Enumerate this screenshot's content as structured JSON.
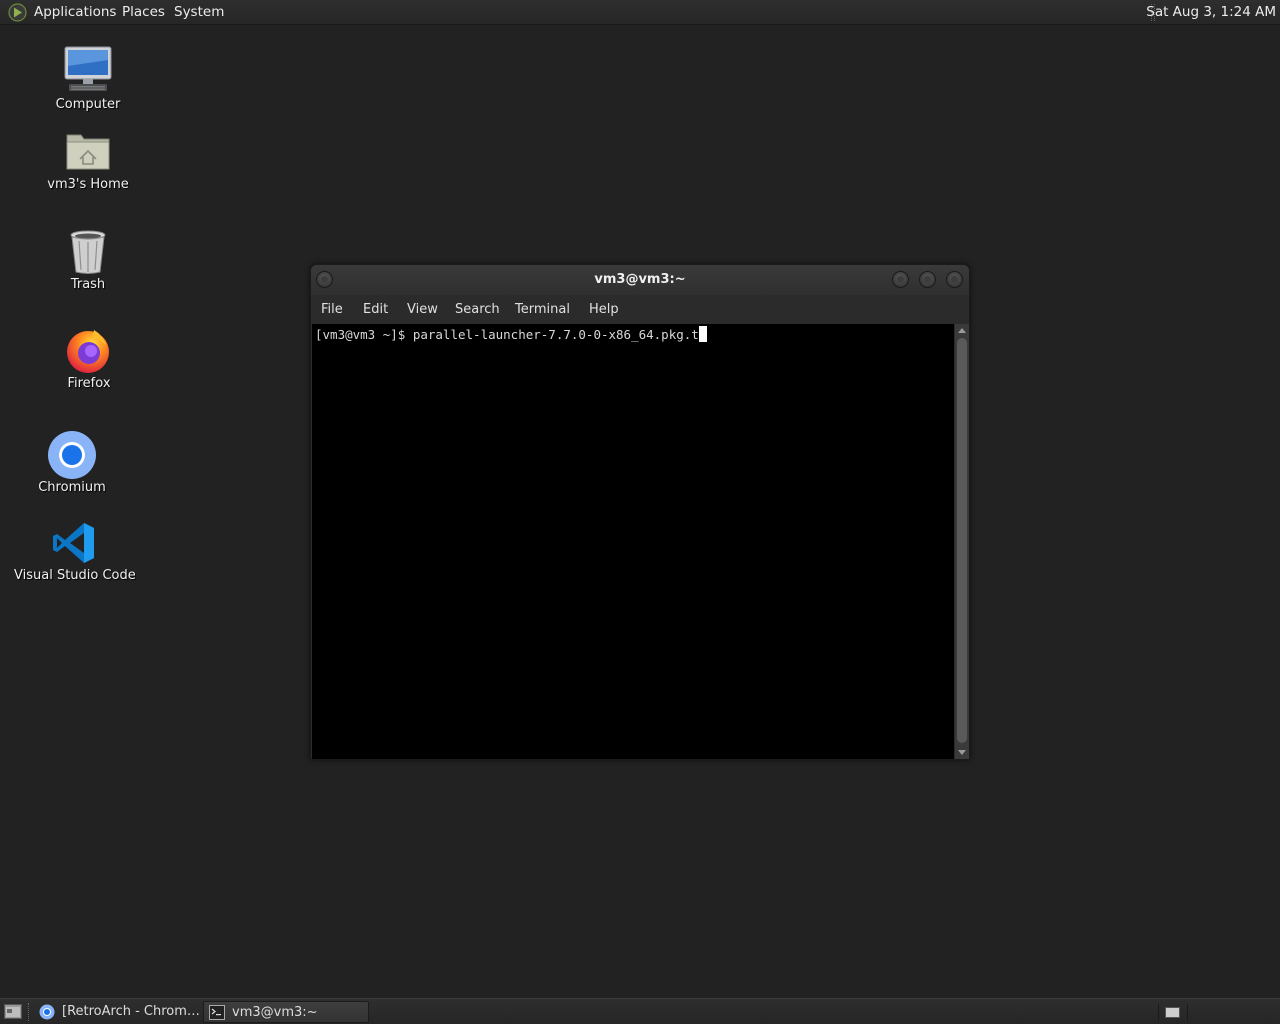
{
  "top_panel": {
    "menus": [
      "Applications",
      "Places",
      "System"
    ],
    "clock": "Sat Aug  3,  1:24 AM"
  },
  "desktop": {
    "icons": [
      {
        "label": "Computer",
        "icon": "computer-icon"
      },
      {
        "label": "vm3's Home",
        "icon": "home-folder-icon"
      },
      {
        "label": "Trash",
        "icon": "trash-icon"
      },
      {
        "label": "Firefox",
        "icon": "firefox-icon"
      },
      {
        "label": "Chromium",
        "icon": "chromium-icon"
      },
      {
        "label": "Visual Studio Code",
        "icon": "vscode-icon"
      }
    ]
  },
  "terminal": {
    "title": "vm3@vm3:~",
    "menus": [
      "File",
      "Edit",
      "View",
      "Search",
      "Terminal",
      "Help"
    ],
    "line": "[vm3@vm3 ~]$ parallel-launcher-7.7.0-0-x86_64.pkg.t"
  },
  "taskbar": {
    "tasks": [
      {
        "label": "[RetroArch - Chrom…",
        "icon": "chromium-icon",
        "active": false
      },
      {
        "label": "vm3@vm3:~",
        "icon": "terminal-icon",
        "active": true
      }
    ]
  },
  "colors": {
    "desktop_bg": "#222222",
    "terminal_bg": "#000000",
    "panel_bg": "#2a2a2a"
  }
}
